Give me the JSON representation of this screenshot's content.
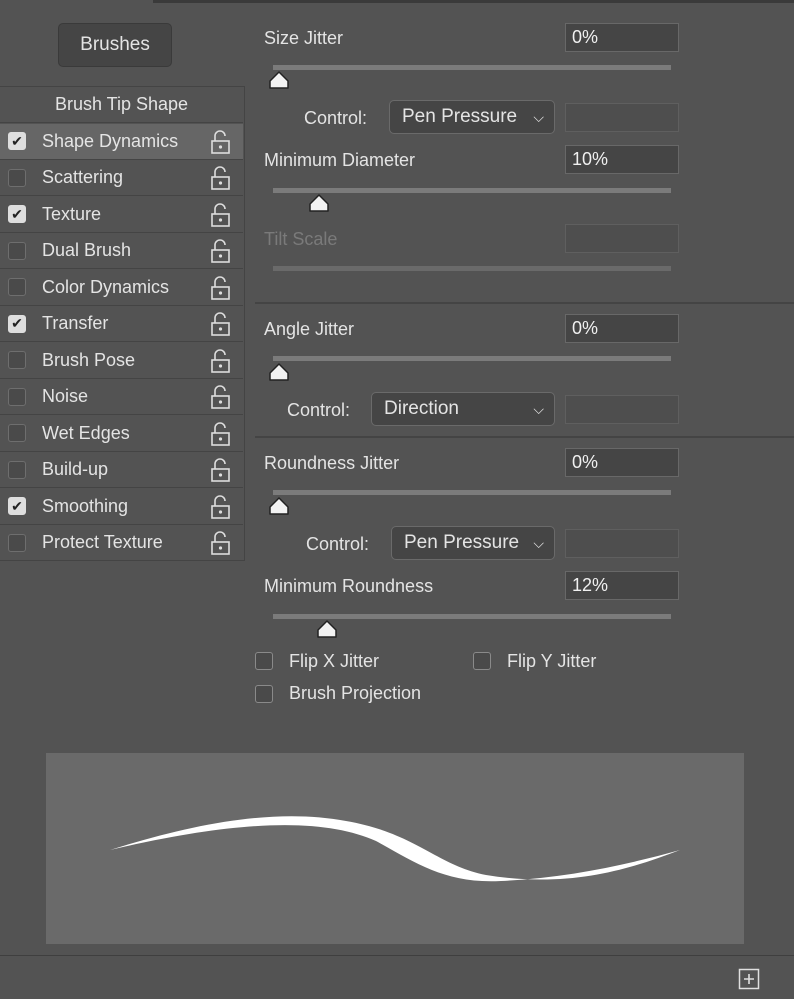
{
  "header": {
    "brushes_label": "Brushes"
  },
  "sidebar": {
    "head": "Brush Tip Shape",
    "items": [
      {
        "label": "Shape Dynamics",
        "checked": true,
        "selected": true
      },
      {
        "label": "Scattering",
        "checked": false
      },
      {
        "label": "Texture",
        "checked": true
      },
      {
        "label": "Dual Brush",
        "checked": false
      },
      {
        "label": "Color Dynamics",
        "checked": false
      },
      {
        "label": "Transfer",
        "checked": true
      },
      {
        "label": "Brush Pose",
        "checked": false
      },
      {
        "label": "Noise",
        "checked": false
      },
      {
        "label": "Wet Edges",
        "checked": false
      },
      {
        "label": "Build-up",
        "checked": false
      },
      {
        "label": "Smoothing",
        "checked": true
      },
      {
        "label": "Protect Texture",
        "checked": false
      }
    ]
  },
  "size_jitter": {
    "label": "Size Jitter",
    "value": "0%",
    "percent": 0,
    "control_label": "Control:",
    "control": "Pen Pressure"
  },
  "min_diameter": {
    "label": "Minimum Diameter",
    "value": "10%",
    "percent": 10
  },
  "tilt_scale": {
    "label": "Tilt Scale",
    "value": "",
    "disabled": true
  },
  "angle_jitter": {
    "label": "Angle Jitter",
    "value": "0%",
    "percent": 0,
    "control_label": "Control:",
    "control": "Direction"
  },
  "roundness_jitter": {
    "label": "Roundness Jitter",
    "value": "0%",
    "percent": 0,
    "control_label": "Control:",
    "control": "Pen Pressure"
  },
  "min_roundness": {
    "label": "Minimum Roundness",
    "value": "12%",
    "percent": 12
  },
  "options": {
    "flip_x": "Flip X Jitter",
    "flip_y": "Flip Y Jitter",
    "projection": "Brush Projection"
  },
  "footer": {
    "icon": "new-brush-icon"
  }
}
